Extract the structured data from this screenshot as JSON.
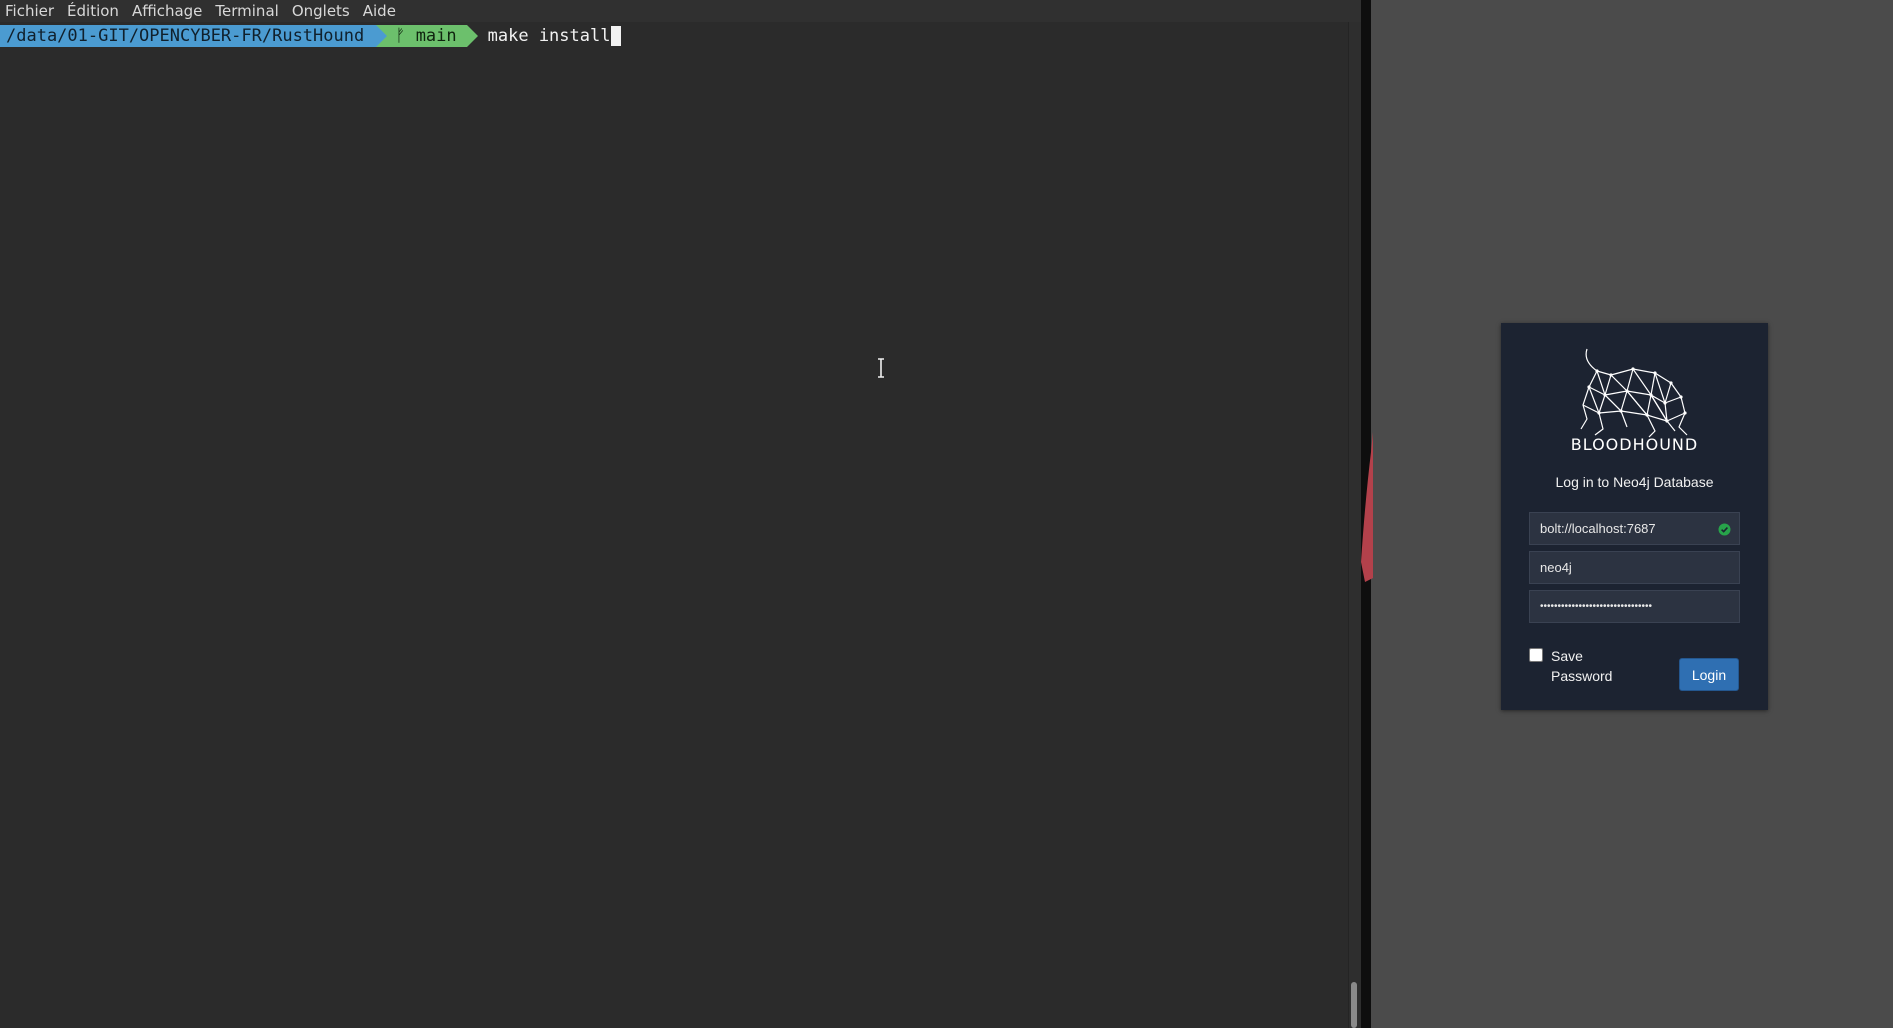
{
  "terminal": {
    "menu": [
      "Fichier",
      "Édition",
      "Affichage",
      "Terminal",
      "Onglets",
      "Aide"
    ],
    "prompt": {
      "path": "/data/01-GIT/OPENCYBER-FR/RustHound",
      "branch_icon": "git-branch-icon",
      "branch": "main",
      "command": "make install"
    }
  },
  "login": {
    "brand": "BLOODHOUND",
    "subtitle": "Log in to Neo4j Database",
    "url_value": "bolt://localhost:7687",
    "url_status_icon": "check-circle-icon",
    "url_status_color": "#27a34a",
    "username_value": "neo4j",
    "password_value": "••••••••••••••••••••••••••••••••",
    "save_password_label": "Save Password",
    "save_password_checked": false,
    "login_button_label": "Login",
    "button_color": "#2f6fb2"
  }
}
